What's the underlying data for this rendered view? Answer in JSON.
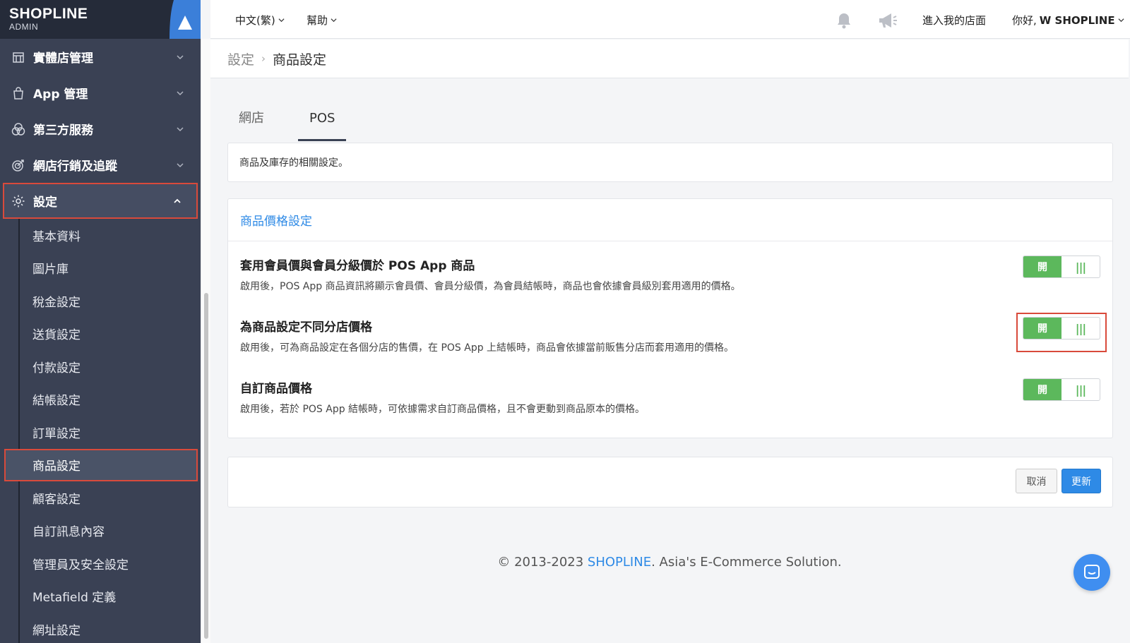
{
  "brand": {
    "logo_text": "SHOPLINE",
    "logo_sub": "ADMIN"
  },
  "sidebar": {
    "items": [
      {
        "label": "實體店管理",
        "icon": "store-icon"
      },
      {
        "label": "App 管理",
        "icon": "shopping-bag-icon"
      },
      {
        "label": "第三方服務",
        "icon": "overlap-circles-icon"
      },
      {
        "label": "網店行銷及追蹤",
        "icon": "target-icon"
      },
      {
        "label": "設定",
        "icon": "gear-icon",
        "active": true
      }
    ],
    "submenu": [
      "基本資料",
      "圖片庫",
      "稅金設定",
      "送貨設定",
      "付款設定",
      "結帳設定",
      "訂單設定",
      "商品設定",
      "顧客設定",
      "自訂訊息內容",
      "管理員及安全設定",
      "Metafield 定義",
      "網址設定"
    ],
    "active_sub": "商品設定"
  },
  "topbar": {
    "language": "中文(繁)",
    "help": "幫助",
    "store_link": "進入我的店面",
    "greeting": "你好,",
    "user_name": "W SHOPLINE"
  },
  "breadcrumb": {
    "parent": "設定",
    "current": "商品設定"
  },
  "tabs": {
    "web": "網店",
    "pos": "POS"
  },
  "description": "商品及庫存的相關設定。",
  "price_section": {
    "title": "商品價格設定",
    "settings": [
      {
        "title": "套用會員價與會員分級價於 POS App 商品",
        "desc": "啟用後，POS App 商品資訊將顯示會員價、會員分級價，為會員結帳時，商品也會依據會員級別套用適用的價格。",
        "toggle_label": "開",
        "enabled": true
      },
      {
        "title": "為商品設定不同分店價格",
        "desc": "啟用後，可為商品設定在各個分店的售價，在 POS App 上結帳時，商品會依據當前販售分店而套用適用的價格。",
        "toggle_label": "開",
        "enabled": true
      },
      {
        "title": "自訂商品價格",
        "desc": "啟用後，若於 POS App 結帳時，可依據需求自訂商品價格，且不會更動到商品原本的價格。",
        "toggle_label": "開",
        "enabled": true
      }
    ]
  },
  "actions": {
    "cancel": "取消",
    "update": "更新"
  },
  "footer": {
    "prefix": "© 2013-2023 ",
    "brand": "SHOPLINE",
    "suffix": ". Asia's E-Commerce Solution."
  },
  "colors": {
    "sidebar_bg": "#3a4154",
    "accent_blue": "#2e8ae6",
    "toggle_green": "#5cb85c",
    "highlight_red": "#d94a3b"
  }
}
